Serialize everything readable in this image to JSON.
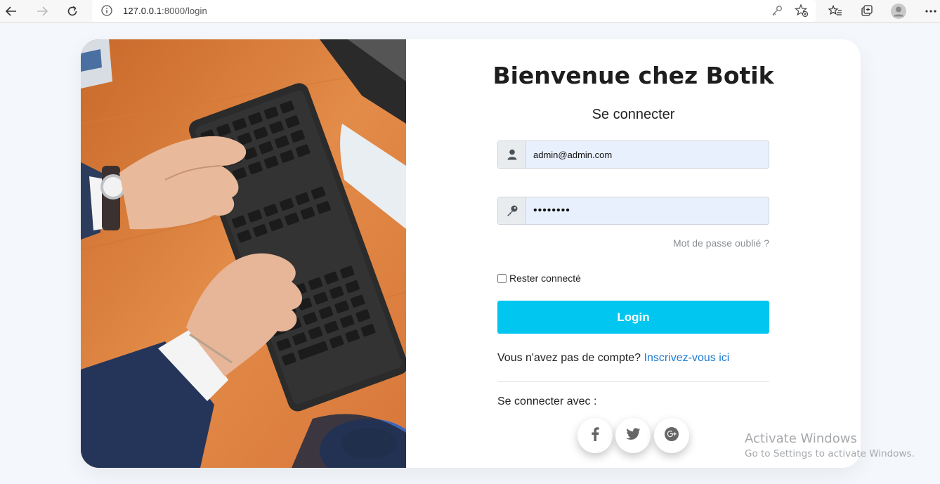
{
  "browser": {
    "url_host": "127.0.0.1",
    "url_path": ":8000/login",
    "icons": [
      "back-icon",
      "forward-icon",
      "reload-icon",
      "info-icon",
      "key-icon",
      "add-favorite-icon",
      "favorites-icon",
      "collections-icon",
      "profile-avatar",
      "more-icon"
    ]
  },
  "login": {
    "title": "Bienvenue chez Botik",
    "subtitle": "Se connecter",
    "email_value": "admin@admin.com",
    "password_value": "••••••••",
    "forgot": "Mot de passe oublié ?",
    "remember": "Rester connecté",
    "button": "Login",
    "no_account": "Vous n'avez pas de compte? ",
    "signup_link": "Inscrivez-vous ici",
    "login_with": "Se connecter avec :",
    "social": [
      "facebook-icon",
      "twitter-icon",
      "google-plus-icon"
    ]
  },
  "watermark": {
    "line1": "Activate Windows",
    "line2": "Go to Settings to activate Windows."
  },
  "colors": {
    "accent": "#01c6ef",
    "link": "#1e7bd6",
    "input_bg": "#e8f0fe",
    "page_bg": "#f4f7fb"
  }
}
